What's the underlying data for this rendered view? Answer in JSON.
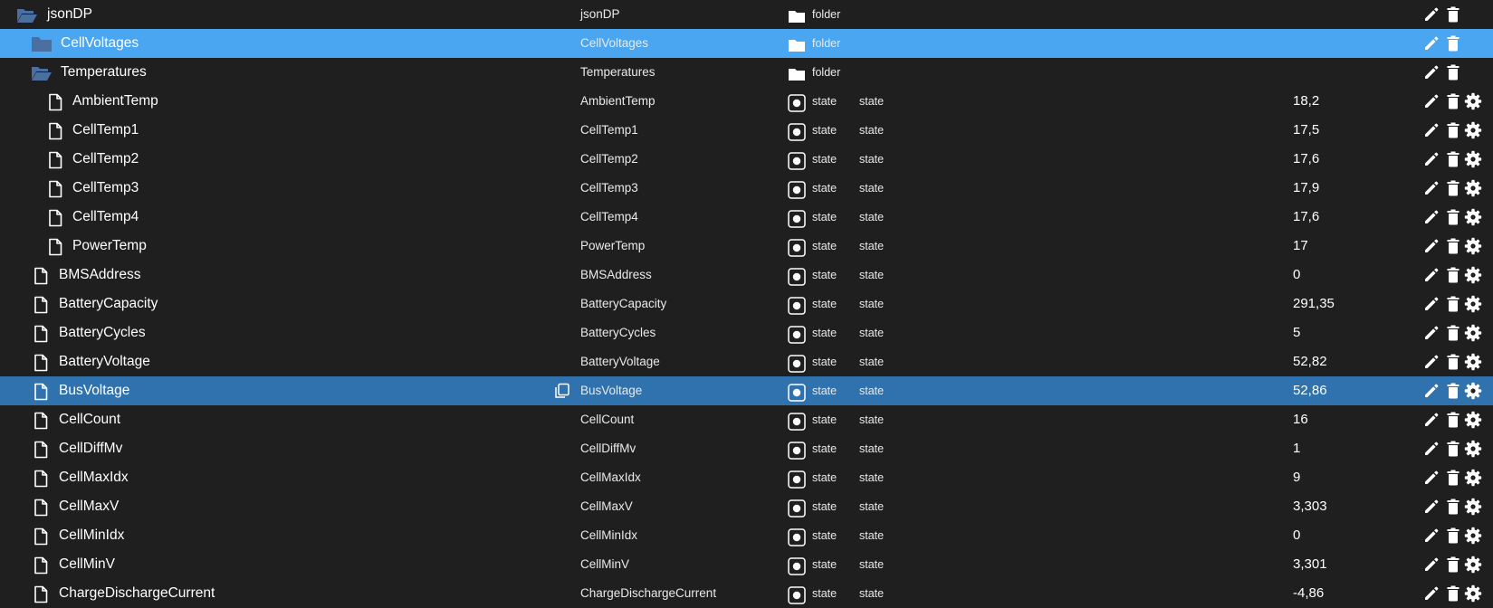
{
  "colors": {
    "background": "#1f1f1f",
    "selected_light": "#4aa6f0",
    "selected_dark": "#2f72ad",
    "folder_icon": "#4b6fa0",
    "text": "#ffffff"
  },
  "icons": {
    "folder_open": "folder-open-icon",
    "folder_closed": "folder-icon",
    "file": "file-icon",
    "copy": "copy-icon",
    "type_folder": "folder-icon",
    "type_state": "state-icon",
    "edit": "pencil-icon",
    "delete": "trash-icon",
    "settings": "gear-icon"
  },
  "rows": [
    {
      "name": "jsonDP",
      "icon": "folder-open",
      "level": 0,
      "col_name": "jsonDP",
      "type": "folder",
      "type_label": "folder",
      "role": "",
      "value": "",
      "settings": false,
      "highlight": ""
    },
    {
      "name": "CellVoltages",
      "icon": "folder-closed",
      "level": 1,
      "col_name": "CellVoltages",
      "type": "folder",
      "type_label": "folder",
      "role": "",
      "value": "",
      "settings": false,
      "highlight": "light"
    },
    {
      "name": "Temperatures",
      "icon": "folder-open",
      "level": 1,
      "col_name": "Temperatures",
      "type": "folder",
      "type_label": "folder",
      "role": "",
      "value": "",
      "settings": false,
      "highlight": ""
    },
    {
      "name": "AmbientTemp",
      "icon": "file",
      "level": 2,
      "col_name": "AmbientTemp",
      "type": "state",
      "type_label": "state",
      "role": "state",
      "value": "18,2",
      "settings": true,
      "highlight": ""
    },
    {
      "name": "CellTemp1",
      "icon": "file",
      "level": 2,
      "col_name": "CellTemp1",
      "type": "state",
      "type_label": "state",
      "role": "state",
      "value": "17,5",
      "settings": true,
      "highlight": ""
    },
    {
      "name": "CellTemp2",
      "icon": "file",
      "level": 2,
      "col_name": "CellTemp2",
      "type": "state",
      "type_label": "state",
      "role": "state",
      "value": "17,6",
      "settings": true,
      "highlight": ""
    },
    {
      "name": "CellTemp3",
      "icon": "file",
      "level": 2,
      "col_name": "CellTemp3",
      "type": "state",
      "type_label": "state",
      "role": "state",
      "value": "17,9",
      "settings": true,
      "highlight": ""
    },
    {
      "name": "CellTemp4",
      "icon": "file",
      "level": 2,
      "col_name": "CellTemp4",
      "type": "state",
      "type_label": "state",
      "role": "state",
      "value": "17,6",
      "settings": true,
      "highlight": ""
    },
    {
      "name": "PowerTemp",
      "icon": "file",
      "level": 2,
      "col_name": "PowerTemp",
      "type": "state",
      "type_label": "state",
      "role": "state",
      "value": "17",
      "settings": true,
      "highlight": ""
    },
    {
      "name": "BMSAddress",
      "icon": "file",
      "level": 1,
      "col_name": "BMSAddress",
      "type": "state",
      "type_label": "state",
      "role": "state",
      "value": "0",
      "settings": true,
      "highlight": ""
    },
    {
      "name": "BatteryCapacity",
      "icon": "file",
      "level": 1,
      "col_name": "BatteryCapacity",
      "type": "state",
      "type_label": "state",
      "role": "state",
      "value": "291,35",
      "settings": true,
      "highlight": ""
    },
    {
      "name": "BatteryCycles",
      "icon": "file",
      "level": 1,
      "col_name": "BatteryCycles",
      "type": "state",
      "type_label": "state",
      "role": "state",
      "value": "5",
      "settings": true,
      "highlight": ""
    },
    {
      "name": "BatteryVoltage",
      "icon": "file",
      "level": 1,
      "col_name": "BatteryVoltage",
      "type": "state",
      "type_label": "state",
      "role": "state",
      "value": "52,82",
      "settings": true,
      "highlight": ""
    },
    {
      "name": "BusVoltage",
      "icon": "file",
      "level": 1,
      "col_name": "BusVoltage",
      "type": "state",
      "type_label": "state",
      "role": "state",
      "value": "52,86",
      "settings": true,
      "highlight": "dark",
      "copy": true
    },
    {
      "name": "CellCount",
      "icon": "file",
      "level": 1,
      "col_name": "CellCount",
      "type": "state",
      "type_label": "state",
      "role": "state",
      "value": "16",
      "settings": true,
      "highlight": ""
    },
    {
      "name": "CellDiffMv",
      "icon": "file",
      "level": 1,
      "col_name": "CellDiffMv",
      "type": "state",
      "type_label": "state",
      "role": "state",
      "value": "1",
      "settings": true,
      "highlight": ""
    },
    {
      "name": "CellMaxIdx",
      "icon": "file",
      "level": 1,
      "col_name": "CellMaxIdx",
      "type": "state",
      "type_label": "state",
      "role": "state",
      "value": "9",
      "settings": true,
      "highlight": ""
    },
    {
      "name": "CellMaxV",
      "icon": "file",
      "level": 1,
      "col_name": "CellMaxV",
      "type": "state",
      "type_label": "state",
      "role": "state",
      "value": "3,303",
      "settings": true,
      "highlight": ""
    },
    {
      "name": "CellMinIdx",
      "icon": "file",
      "level": 1,
      "col_name": "CellMinIdx",
      "type": "state",
      "type_label": "state",
      "role": "state",
      "value": "0",
      "settings": true,
      "highlight": ""
    },
    {
      "name": "CellMinV",
      "icon": "file",
      "level": 1,
      "col_name": "CellMinV",
      "type": "state",
      "type_label": "state",
      "role": "state",
      "value": "3,301",
      "settings": true,
      "highlight": ""
    },
    {
      "name": "ChargeDischargeCurrent",
      "icon": "file",
      "level": 1,
      "col_name": "ChargeDischargeCurrent",
      "type": "state",
      "type_label": "state",
      "role": "state",
      "value": "-4,86",
      "settings": true,
      "highlight": ""
    }
  ]
}
